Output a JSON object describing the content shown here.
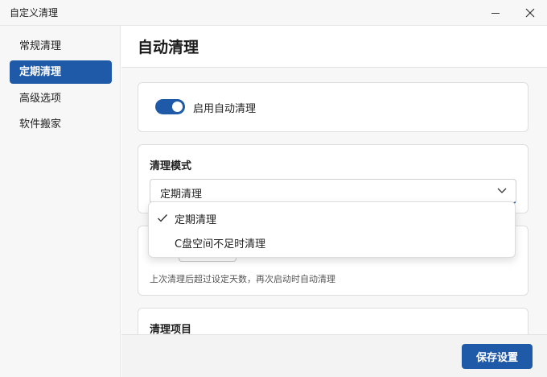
{
  "window": {
    "title": "自定义清理",
    "minimize_icon": "minimize-icon",
    "close_icon": "close-icon"
  },
  "sidebar": {
    "items": [
      {
        "label": "常规清理",
        "active": false
      },
      {
        "label": "定期清理",
        "active": true
      },
      {
        "label": "高级选项",
        "active": false
      },
      {
        "label": "软件搬家",
        "active": false
      }
    ]
  },
  "main": {
    "title": "自动清理",
    "auto_clean": {
      "label": "启用自动清理",
      "enabled": true
    },
    "mode": {
      "title": "清理模式",
      "selected": "定期清理",
      "options": [
        {
          "label": "定期清理",
          "checked": true
        },
        {
          "label": "C盘空间不足时清理",
          "checked": false
        }
      ]
    },
    "schedule": {
      "hint": "上次清理后超过设定天数，再次启动时自动清理"
    },
    "items_section": {
      "title": "清理项目"
    },
    "save_label": "保存设置"
  },
  "colors": {
    "accent": "#1f5aa8",
    "background": "#f7f7f7"
  }
}
